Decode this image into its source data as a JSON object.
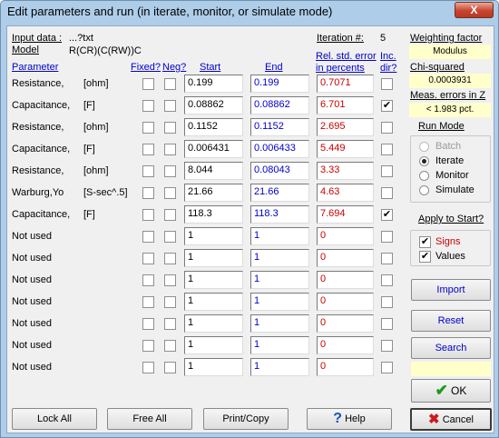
{
  "window": {
    "title": "Edit parameters and run (in iterate, monitor, or simulate mode)",
    "close_glyph": "X"
  },
  "header": {
    "input_data_label": "Input data :",
    "input_data_value": "...?txt",
    "model_label": "Model",
    "model_value": "R(CR)(C(RW))C",
    "iteration_label": "Iteration #:",
    "iteration_value": "5"
  },
  "columns": {
    "parameter": "Parameter",
    "fixed": "Fixed?",
    "neg": "Neg?",
    "start": "Start",
    "end": "End",
    "rel_err_1": "Rel. std. error",
    "rel_err_2": "in percents",
    "inc_1": "Inc.",
    "inc_2": "dir?"
  },
  "rows": [
    {
      "name": "Resistance,",
      "unit": "[ohm]",
      "fixed": false,
      "neg": false,
      "start": "0.199",
      "end": "0.199",
      "err": "0.7071",
      "inc": false
    },
    {
      "name": "Capacitance,",
      "unit": "[F]",
      "fixed": false,
      "neg": false,
      "start": "0.08862",
      "end": "0.08862",
      "err": "6.701",
      "inc": true
    },
    {
      "name": "Resistance,",
      "unit": "[ohm]",
      "fixed": false,
      "neg": false,
      "start": "0.1152",
      "end": "0.1152",
      "err": "2.695",
      "inc": false
    },
    {
      "name": "Capacitance,",
      "unit": "[F]",
      "fixed": false,
      "neg": false,
      "start": "0.006431",
      "end": "0.006433",
      "err": "5.449",
      "inc": false
    },
    {
      "name": "Resistance,",
      "unit": "[ohm]",
      "fixed": false,
      "neg": false,
      "start": "8.044",
      "end": "0.08043",
      "err": "3.33",
      "inc": false
    },
    {
      "name": "Warburg,Yo",
      "unit": "[S-sec^.5]",
      "fixed": false,
      "neg": false,
      "start": "21.66",
      "end": "21.66",
      "err": "4.63",
      "inc": false
    },
    {
      "name": "Capacitance,",
      "unit": "[F]",
      "fixed": false,
      "neg": false,
      "start": "118.3",
      "end": "118.3",
      "err": "7.694",
      "inc": true
    },
    {
      "name": "Not used",
      "unit": "",
      "fixed": false,
      "neg": false,
      "start": "1",
      "end": "1",
      "err": "0",
      "inc": false
    },
    {
      "name": "Not used",
      "unit": "",
      "fixed": false,
      "neg": false,
      "start": "1",
      "end": "1",
      "err": "0",
      "inc": false
    },
    {
      "name": "Not used",
      "unit": "",
      "fixed": false,
      "neg": false,
      "start": "1",
      "end": "1",
      "err": "0",
      "inc": false
    },
    {
      "name": "Not used",
      "unit": "",
      "fixed": false,
      "neg": false,
      "start": "1",
      "end": "1",
      "err": "0",
      "inc": false
    },
    {
      "name": "Not used",
      "unit": "",
      "fixed": false,
      "neg": false,
      "start": "1",
      "end": "1",
      "err": "0",
      "inc": false
    },
    {
      "name": "Not used",
      "unit": "",
      "fixed": false,
      "neg": false,
      "start": "1",
      "end": "1",
      "err": "0",
      "inc": false
    },
    {
      "name": "Not used",
      "unit": "",
      "fixed": false,
      "neg": false,
      "start": "1",
      "end": "1",
      "err": "0",
      "inc": false
    }
  ],
  "side": {
    "weighting_label": "Weighting factor",
    "weighting_value": "Modulus",
    "chi_label": "Chi-squared",
    "chi_value": "0.0003931",
    "meas_label": "Meas. errors in Z",
    "meas_value": "< 1.983 pct.",
    "run_mode_label": "Run Mode",
    "modes": [
      {
        "label": "Batch",
        "selected": false,
        "disabled": true
      },
      {
        "label": "Iterate",
        "selected": true,
        "disabled": false
      },
      {
        "label": "Monitor",
        "selected": false,
        "disabled": false
      },
      {
        "label": "Simulate",
        "selected": false,
        "disabled": false
      }
    ],
    "apply_label": "Apply to Start?",
    "signs_label": "Signs",
    "signs_checked": true,
    "values_label": "Values",
    "values_checked": true,
    "import_label": "Import",
    "reset_label": "Reset",
    "search_label": "Search",
    "ok_label": "OK"
  },
  "bottom": {
    "lock_all": "Lock All",
    "free_all": "Free All",
    "print_copy": "Print/Copy",
    "help": "Help",
    "cancel": "Cancel"
  },
  "colors": {
    "accent_blue": "#0000cc",
    "error_red": "#cc0000",
    "highlight_yellow": "#ffffcc",
    "ok_green": "#1c9a1c",
    "cancel_red": "#cc1a1a"
  }
}
